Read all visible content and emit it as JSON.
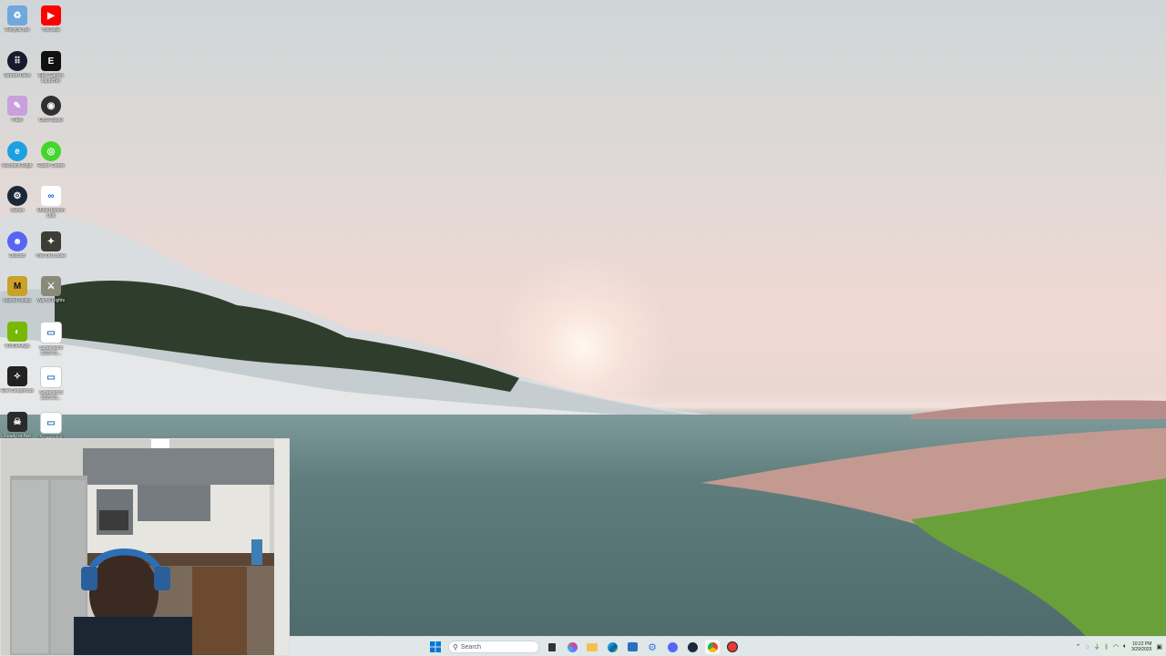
{
  "desktop": {
    "icons": [
      {
        "name": "Recycle Bin",
        "icon": "recycle-bin-icon",
        "color": "#6fa8dc"
      },
      {
        "name": "YouTube",
        "icon": "youtube-icon",
        "color": "#ff0000"
      },
      {
        "name": "Stream Deck",
        "icon": "stream-deck-icon",
        "color": "#1a1a2e"
      },
      {
        "name": "Epic Games Launcher",
        "icon": "epic-games-icon",
        "color": "#111111"
      },
      {
        "name": "Paint",
        "icon": "paint-icon",
        "color": "#c9a0dc"
      },
      {
        "name": "OBS Studio",
        "icon": "obs-icon",
        "color": "#303030"
      },
      {
        "name": "Microsoft Edge",
        "icon": "edge-icon",
        "color": "#1ba1e2"
      },
      {
        "name": "Razer Cortex",
        "icon": "razer-cortex-icon",
        "color": "#44d62c"
      },
      {
        "name": "Steam",
        "icon": "steam-icon",
        "color": "#1b2838"
      },
      {
        "name": "Meta Horizon Link",
        "icon": "meta-icon",
        "color": "#ffffff"
      },
      {
        "name": "Discord",
        "icon": "discord-icon",
        "color": "#5865f2"
      },
      {
        "name": "Hell Let Loose",
        "icon": "hell-let-loose-icon",
        "color": "#3d3d35"
      },
      {
        "name": "Marvel Rivals",
        "icon": "marvel-rivals-icon",
        "color": "#c9a227"
      },
      {
        "name": "War of Rights",
        "icon": "war-of-rights-icon",
        "color": "#8a8a7a"
      },
      {
        "name": "NVIDIA App",
        "icon": "nvidia-icon",
        "color": "#76b900"
      },
      {
        "name": "Screenshot 2025-01...",
        "icon": "screenshot-file-icon",
        "color": "#ffffff"
      },
      {
        "name": "Elite Dangerous",
        "icon": "elite-dangerous-icon",
        "color": "#222222"
      },
      {
        "name": "Screenshot 2025-01...",
        "icon": "screenshot-file-icon",
        "color": "#ffffff"
      },
      {
        "name": "Ready or Not",
        "icon": "ready-or-not-icon",
        "color": "#2b2b2b"
      },
      {
        "name": "Screenshot",
        "icon": "screenshot-file-icon",
        "color": "#ffffff"
      }
    ]
  },
  "taskbar": {
    "search_placeholder": "Search",
    "pinned": [
      {
        "icon": "file-explorer-task-view-icon",
        "color": "#333333"
      },
      {
        "icon": "copilot-icon",
        "color": "#e0457b"
      },
      {
        "icon": "folder-icon",
        "color": "#f2c14e"
      },
      {
        "icon": "edge-icon",
        "color": "#1ba1e2"
      },
      {
        "icon": "store-icon",
        "color": "#2b6fbd"
      },
      {
        "icon": "settings-icon",
        "color": "#3a7bd5"
      },
      {
        "icon": "discord-icon",
        "color": "#5865f2"
      },
      {
        "icon": "steam-icon",
        "color": "#1b2838"
      },
      {
        "icon": "chrome-icon",
        "color": "#4caf50"
      },
      {
        "icon": "record-icon",
        "color": "#e53935"
      }
    ],
    "clock_time": "10:22 PM",
    "clock_date": "3/29/2025"
  },
  "colors": {
    "accent": "#0078d4",
    "taskbar_bg": "#ecf2f4"
  }
}
